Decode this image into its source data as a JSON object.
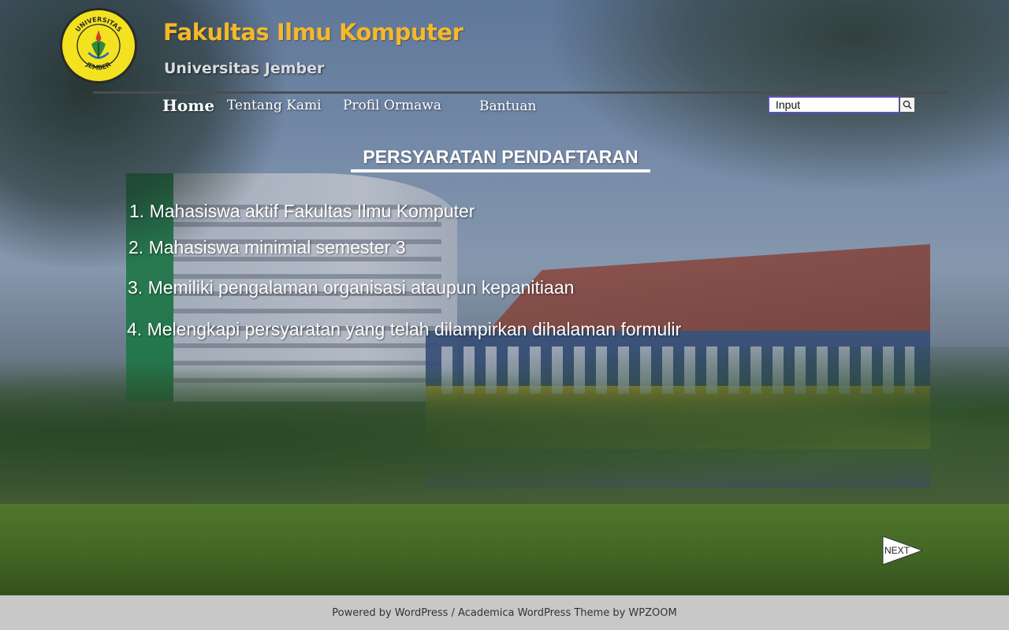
{
  "header": {
    "title": "Fakultas Ilmu Komputer",
    "subtitle": "Universitas Jember",
    "logo": {
      "ring_text_top": "UNIVERSITAS",
      "ring_text_bottom": "JEMBER"
    }
  },
  "nav": {
    "items": [
      {
        "label": "Home"
      },
      {
        "label": "Tentang Kami"
      },
      {
        "label": "Profil Ormawa"
      },
      {
        "label": "Bantuan"
      }
    ]
  },
  "search": {
    "value": "Input",
    "icon": "search-icon"
  },
  "main": {
    "title": "PERSYARATAN PENDAFTARAN",
    "requirements": [
      "1. Mahasiswa aktif Fakultas Ilmu Komputer",
      "2. Mahasiswa minimial semester 3",
      "3. Memiliki pengalaman organisasi ataupun kepanitiaan",
      "4. Melengkapi persyaratan yang telah dilampirkan dihalaman formulir"
    ],
    "next_label": "NEXT"
  },
  "footer": {
    "text": "Powered by WordPress / Academica WordPress Theme by WPZOOM"
  },
  "colors": {
    "title": "#f5b82a",
    "footer_bg": "#c8c8c8",
    "search_border": "#5a52b8"
  }
}
